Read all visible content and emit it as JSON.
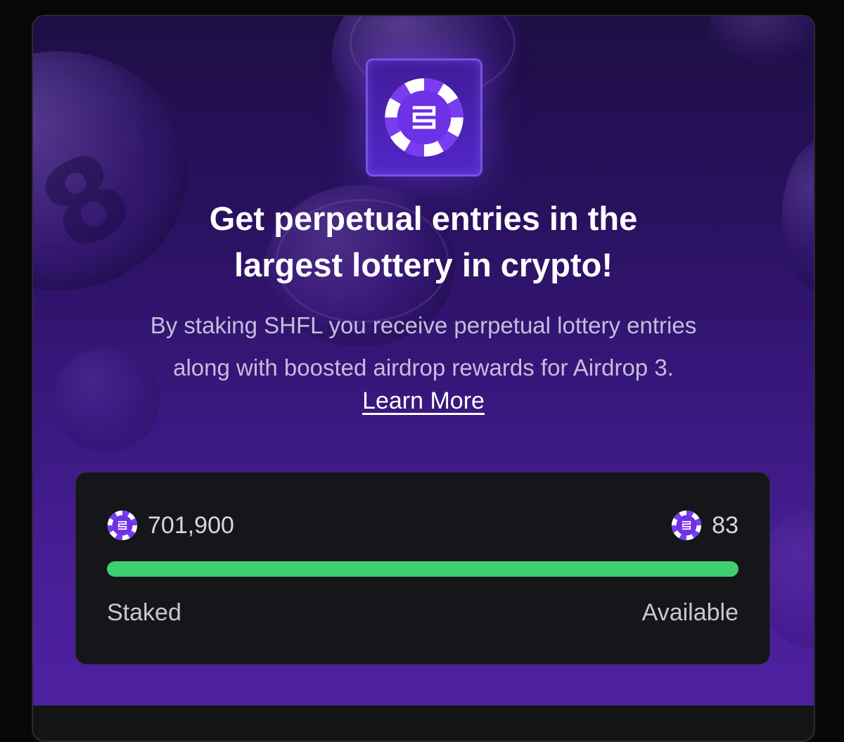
{
  "hero": {
    "headline_line1": "Get perpetual entries in the",
    "headline_line2": "largest lottery in crypto!",
    "description_line1": "By staking SHFL you receive perpetual lottery entries",
    "description_line2": "along with boosted airdrop rewards for Airdrop 3.",
    "learn_more": "Learn More",
    "logo_icon": "shfl-chip-icon"
  },
  "staking": {
    "staked_amount": "701,900",
    "available_amount": "83",
    "staked_label": "Staked",
    "available_label": "Available",
    "progress_fraction": 0.9999,
    "token_icon": "shfl-chip-icon"
  },
  "colors": {
    "accent_purple": "#6b2ee6",
    "progress_green": "#3ecf72",
    "panel_dark": "#151619"
  }
}
